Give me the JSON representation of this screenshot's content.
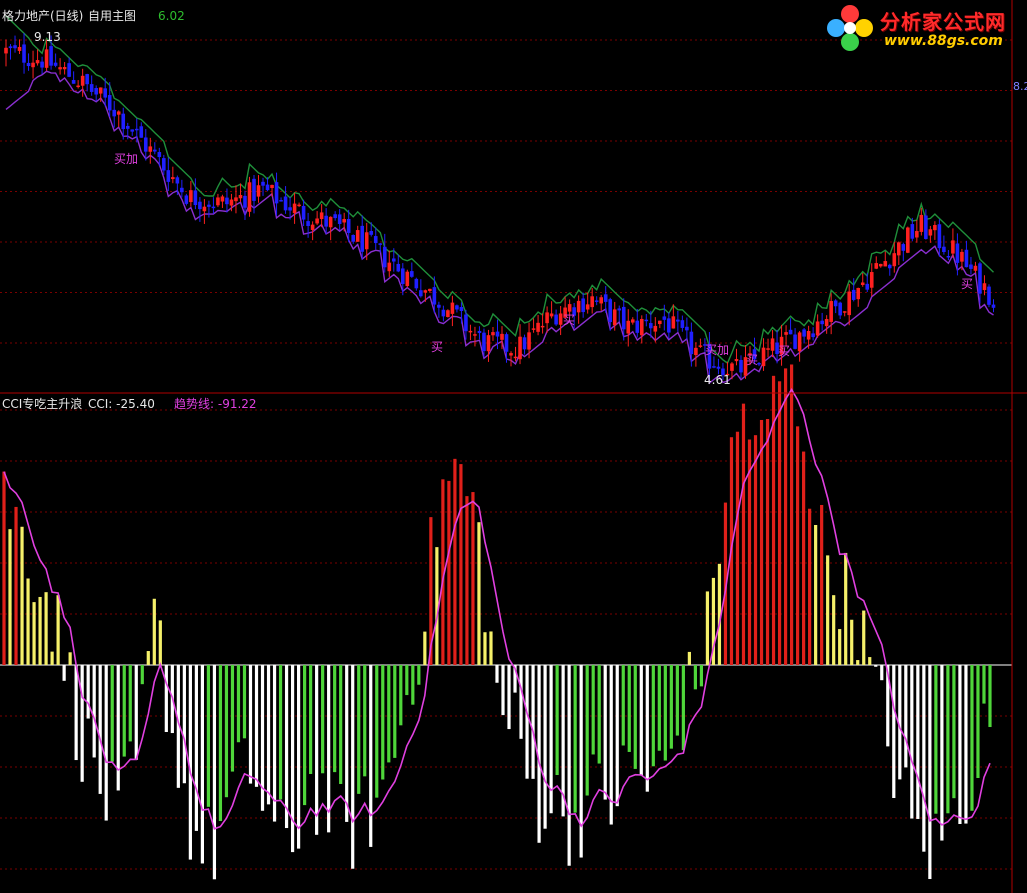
{
  "top_panel": {
    "stock_name": "格力地产(日线)",
    "indicator_name": "自用主图",
    "indicator_value": "6.02",
    "high_label": "9.13",
    "low_label": "4.61",
    "right_price_label": "8.2",
    "buy_label": "买",
    "add_label": "买加",
    "add_label_2": "买加"
  },
  "bottom_panel": {
    "indicator_name": "CCI专吃主升浪",
    "cci_label": "CCI: -25.40",
    "trend_label": "趋势线: -91.22"
  },
  "logo": {
    "title": "分析家公式网",
    "url": "www.88gs.com"
  },
  "colors": {
    "up_candle": "#ff2020",
    "down_candle": "#2020ff",
    "resistance_line": "#1f8f3a",
    "support_line": "#8a2fd0",
    "grid": "#7a0000",
    "bar_yellow": "#f5f06a",
    "bar_red": "#e0201a",
    "bar_green": "#4fd63a",
    "bar_white": "#ffffff",
    "trend_line": "#e040e0",
    "label_white": "#e8e8e8",
    "label_magenta": "#e040e0"
  },
  "chart_data": [
    {
      "type": "candlestick",
      "title": "格力地产(日线) 自用主图",
      "ylim": [
        4.4,
        9.3
      ],
      "price_points": [
        9.0,
        8.9,
        8.6,
        8.2,
        7.6,
        7.0,
        6.9,
        7.1,
        6.8,
        6.6,
        6.3,
        5.9,
        5.5,
        5.0,
        4.9,
        5.4,
        5.6,
        5.2,
        5.3,
        4.8,
        4.6,
        4.9,
        5.2,
        5.6,
        6.1,
        6.6,
        6.2,
        5.6
      ],
      "marks": [
        "9.13",
        "4.61"
      ]
    },
    {
      "type": "bar",
      "title": "CCI专吃主升浪",
      "ylim": [
        -250,
        300
      ],
      "cci": -25.4,
      "trend": -91.22
    }
  ]
}
